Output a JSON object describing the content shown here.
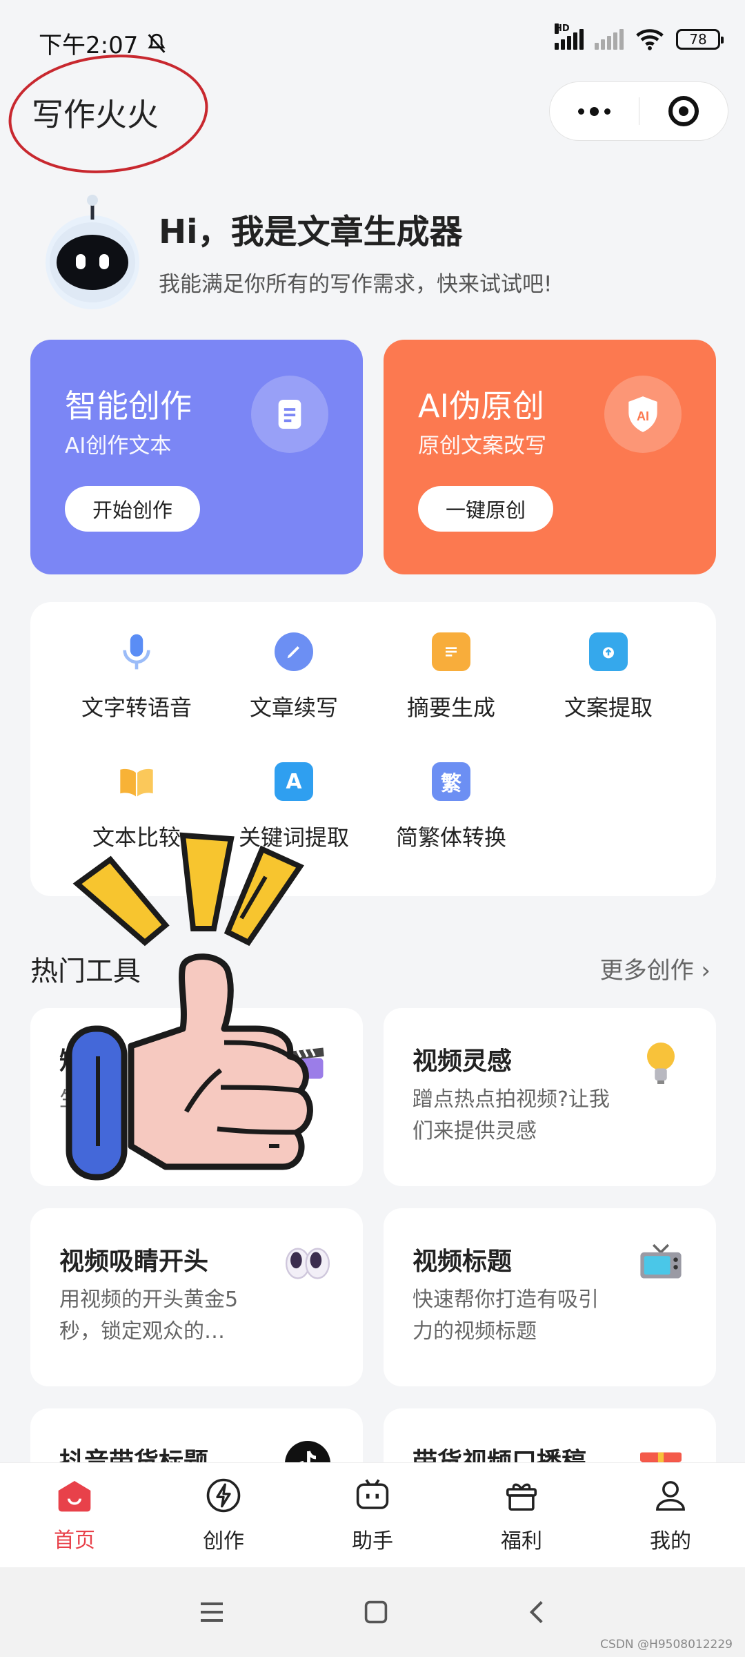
{
  "status_bar": {
    "time": "下午2:07",
    "hd": "HD",
    "battery": "78"
  },
  "header": {
    "app_title": "写作火火"
  },
  "intro": {
    "title": "Hi，我是文章生成器",
    "subtitle": "我能满足你所有的写作需求，快来试试吧!"
  },
  "feature_cards": [
    {
      "title": "智能创作",
      "subtitle": "AI创作文本",
      "button": "开始创作"
    },
    {
      "title": "AI伪原创",
      "subtitle": "原创文案改写",
      "button": "一键原创",
      "badge": "AI"
    }
  ],
  "tools": [
    {
      "label": "文字转语音",
      "icon": "microphone-icon"
    },
    {
      "label": "文章续写",
      "icon": "pen-icon"
    },
    {
      "label": "摘要生成",
      "icon": "list-icon"
    },
    {
      "label": "文案提取",
      "icon": "upload-box-icon"
    },
    {
      "label": "文本比较",
      "icon": "open-book-icon"
    },
    {
      "label": "关键词提取",
      "icon": "letter-a-icon",
      "glyph": "A"
    },
    {
      "label": "简繁体转换",
      "icon": "traditional-char-icon",
      "glyph": "繁"
    }
  ],
  "hot_section": {
    "title": "热门工具",
    "more": "更多创作"
  },
  "hot_cards": [
    {
      "title": "短",
      "desc": "生 等",
      "icon": "clapperboard-icon"
    },
    {
      "title": "视频灵感",
      "desc": "蹭点热点拍视频?让我们来提供灵感",
      "icon": "lightbulb-icon"
    },
    {
      "title": "视频吸睛开头",
      "desc": "用视频的开头黄金5秒，锁定观众的…",
      "icon": "eyes-icon"
    },
    {
      "title": "视频标题",
      "desc": "快速帮你打造有吸引力的视频标题",
      "icon": "tv-icon"
    },
    {
      "title": "抖音带货标题",
      "desc": "",
      "icon": "tiktok-icon"
    },
    {
      "title": "带货视频口播稿",
      "desc": "",
      "icon": "gift-icon"
    }
  ],
  "bottom_nav": [
    {
      "label": "首页",
      "icon": "home-icon",
      "active": true
    },
    {
      "label": "创作",
      "icon": "lightning-icon"
    },
    {
      "label": "助手",
      "icon": "tv-assistant-icon"
    },
    {
      "label": "福利",
      "icon": "gift-box-icon"
    },
    {
      "label": "我的",
      "icon": "person-icon"
    }
  ],
  "watermark": "CSDN @H9508012229",
  "colors": {
    "blue_card": "#7b86f5",
    "orange_card": "#fc7950",
    "nav_active": "#e8414a",
    "circle_annotation": "#c8282f"
  }
}
